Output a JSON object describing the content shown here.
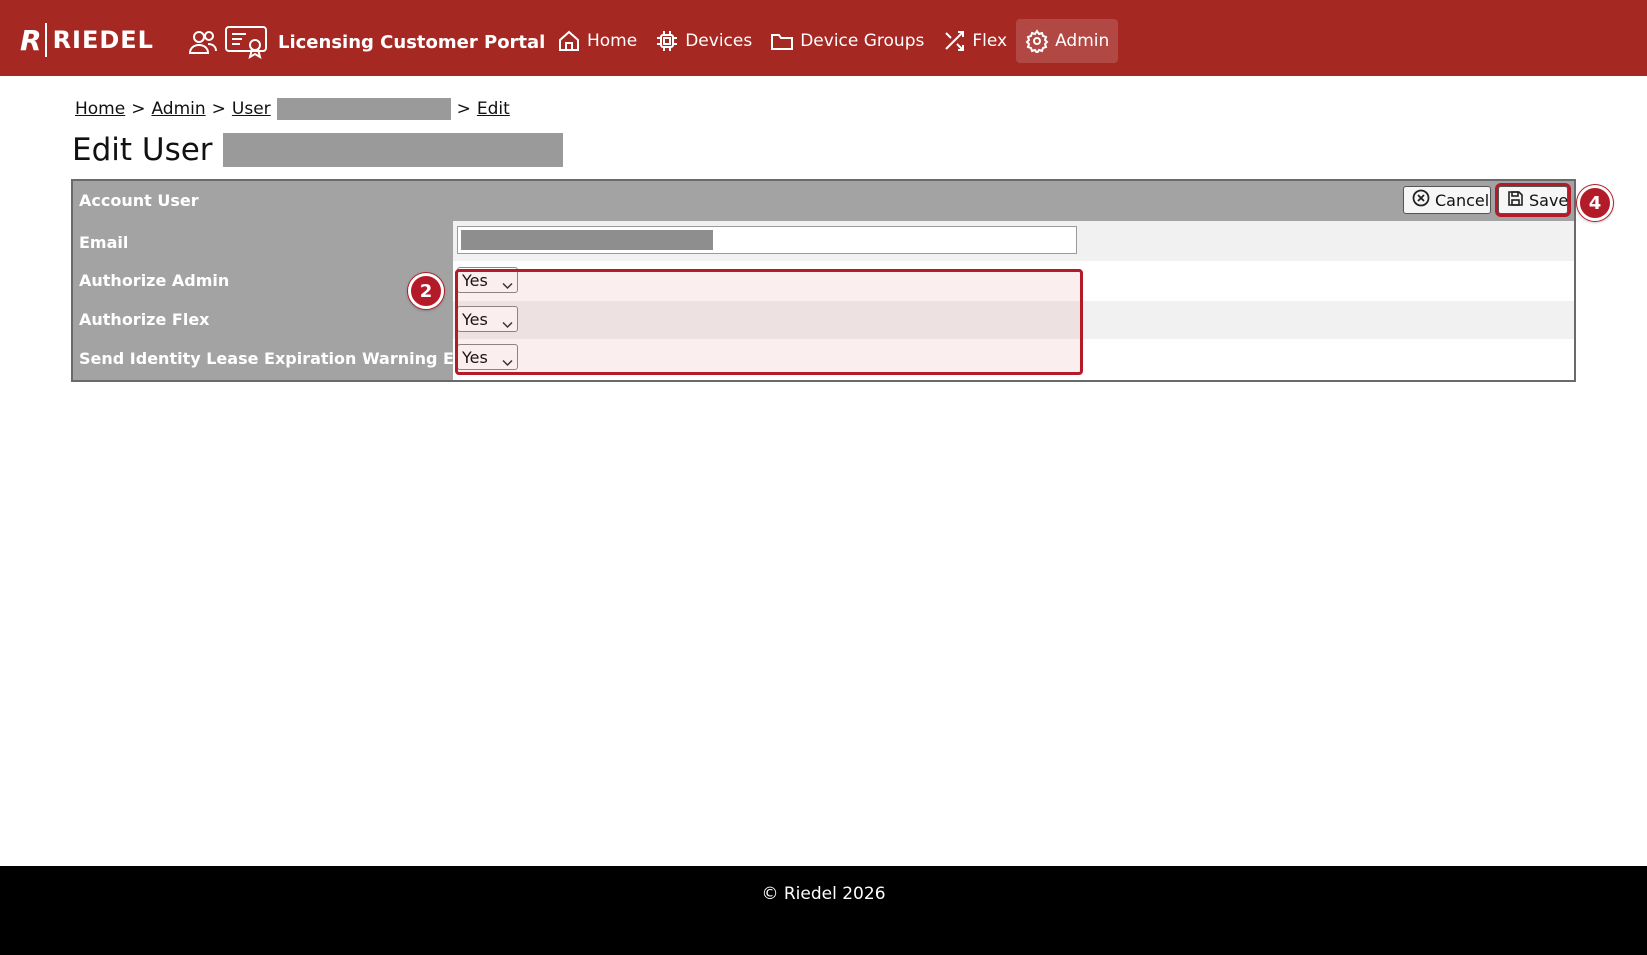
{
  "header": {
    "logo_letter": "R",
    "logo_text": "RIEDEL",
    "portal_title": "Licensing Customer Portal",
    "nav": [
      {
        "label": "Home",
        "icon": "home-icon"
      },
      {
        "label": "Devices",
        "icon": "chip-icon"
      },
      {
        "label": "Device Groups",
        "icon": "folder-icon"
      },
      {
        "label": "Flex",
        "icon": "shuffle-icon"
      },
      {
        "label": "Admin",
        "icon": "gear-icon",
        "active": true
      }
    ]
  },
  "breadcrumb": {
    "home": "Home",
    "admin": "Admin",
    "user": "User",
    "sep": ">",
    "edit": "Edit"
  },
  "page": {
    "title": "Edit User"
  },
  "form": {
    "header_label": "Account User",
    "cancel_label": "Cancel",
    "save_label": "Save",
    "rows": [
      {
        "label": "Email"
      },
      {
        "label": "Authorize Admin",
        "value": "Yes"
      },
      {
        "label": "Authorize Flex",
        "value": "Yes"
      },
      {
        "label": "Send Identity Lease Expiration Warning Email",
        "value": "Yes"
      }
    ]
  },
  "annotations": {
    "step_2": "2",
    "step_4": "4",
    "color": "#b31b28"
  },
  "colors": {
    "brand": "#a52823",
    "panel": "#a3a3a3",
    "footer": "#000000"
  },
  "footer": {
    "text": "© Riedel 2026"
  }
}
